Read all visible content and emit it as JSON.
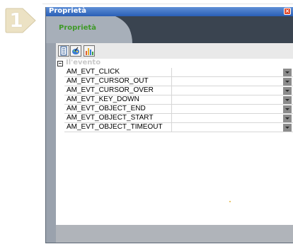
{
  "step": {
    "number": "1"
  },
  "window": {
    "title": "Proprietà"
  },
  "tabs": [
    {
      "label": "Proprietà",
      "active": true
    }
  ],
  "toolbar": {
    "buttons": [
      {
        "icon": "document-list-icon"
      },
      {
        "icon": "paint-icon"
      },
      {
        "icon": "bar-chart-icon"
      }
    ]
  },
  "properties": {
    "group_label": "Il'evento",
    "rows": [
      {
        "name": "AM_EVT_CLICK",
        "value": ""
      },
      {
        "name": "AM_EVT_CURSOR_OUT",
        "value": ""
      },
      {
        "name": "AM_EVT_CURSOR_OVER",
        "value": ""
      },
      {
        "name": "AM_EVT_KEY_DOWN",
        "value": ""
      },
      {
        "name": "AM_EVT_OBJECT_END",
        "value": ""
      },
      {
        "name": "AM_EVT_OBJECT_START",
        "value": ""
      },
      {
        "name": "AM_EVT_OBJECT_TIMEOUT",
        "value": ""
      }
    ]
  },
  "colors": {
    "titlebar": "#2a5fb6",
    "tab_label": "#3f9a28",
    "tab_bar": "#3a4450",
    "close_button": "#e24b2c"
  }
}
